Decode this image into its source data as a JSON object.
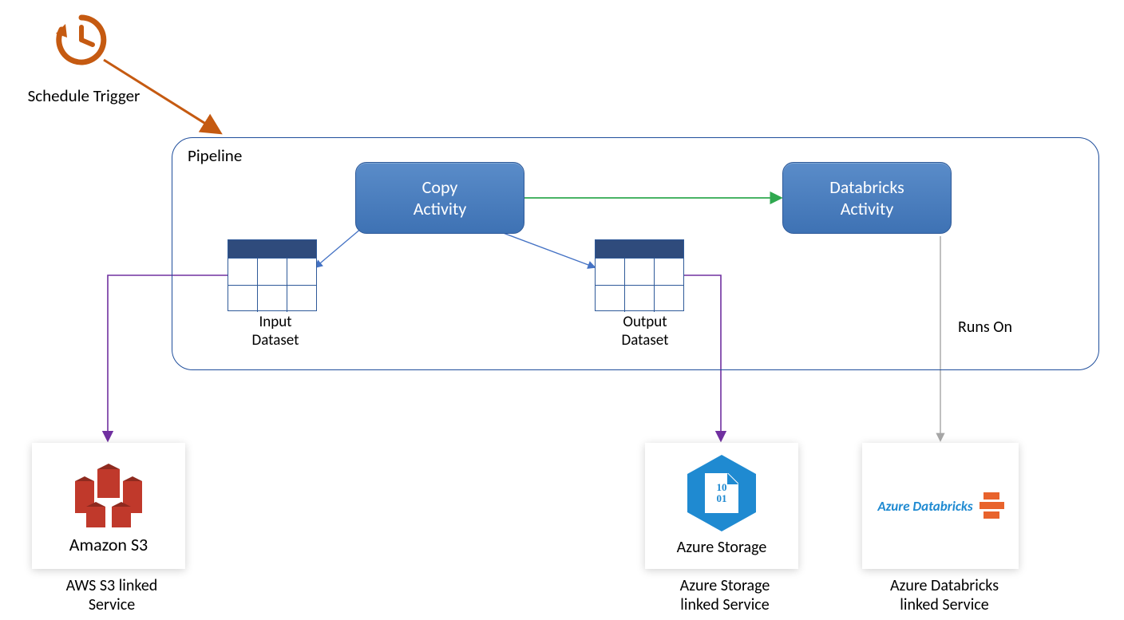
{
  "trigger": {
    "label": "Schedule Trigger"
  },
  "pipeline": {
    "title": "Pipeline",
    "activities": {
      "copy": "Copy\nActivity",
      "databricks": "Databricks\nActivity"
    },
    "datasets": {
      "input": "Input\nDataset",
      "output": "Output\nDataset"
    },
    "runsOn": "Runs On"
  },
  "services": {
    "s3": {
      "logoText": "Amazon S3",
      "caption": "AWS S3 linked\nService"
    },
    "storage": {
      "logoText": "Azure Storage",
      "binary": [
        "10",
        "01"
      ],
      "caption": "Azure Storage\nlinked Service"
    },
    "databricks": {
      "logoText": "Azure Databricks",
      "caption": "Azure Databricks\nlinked Service"
    }
  }
}
